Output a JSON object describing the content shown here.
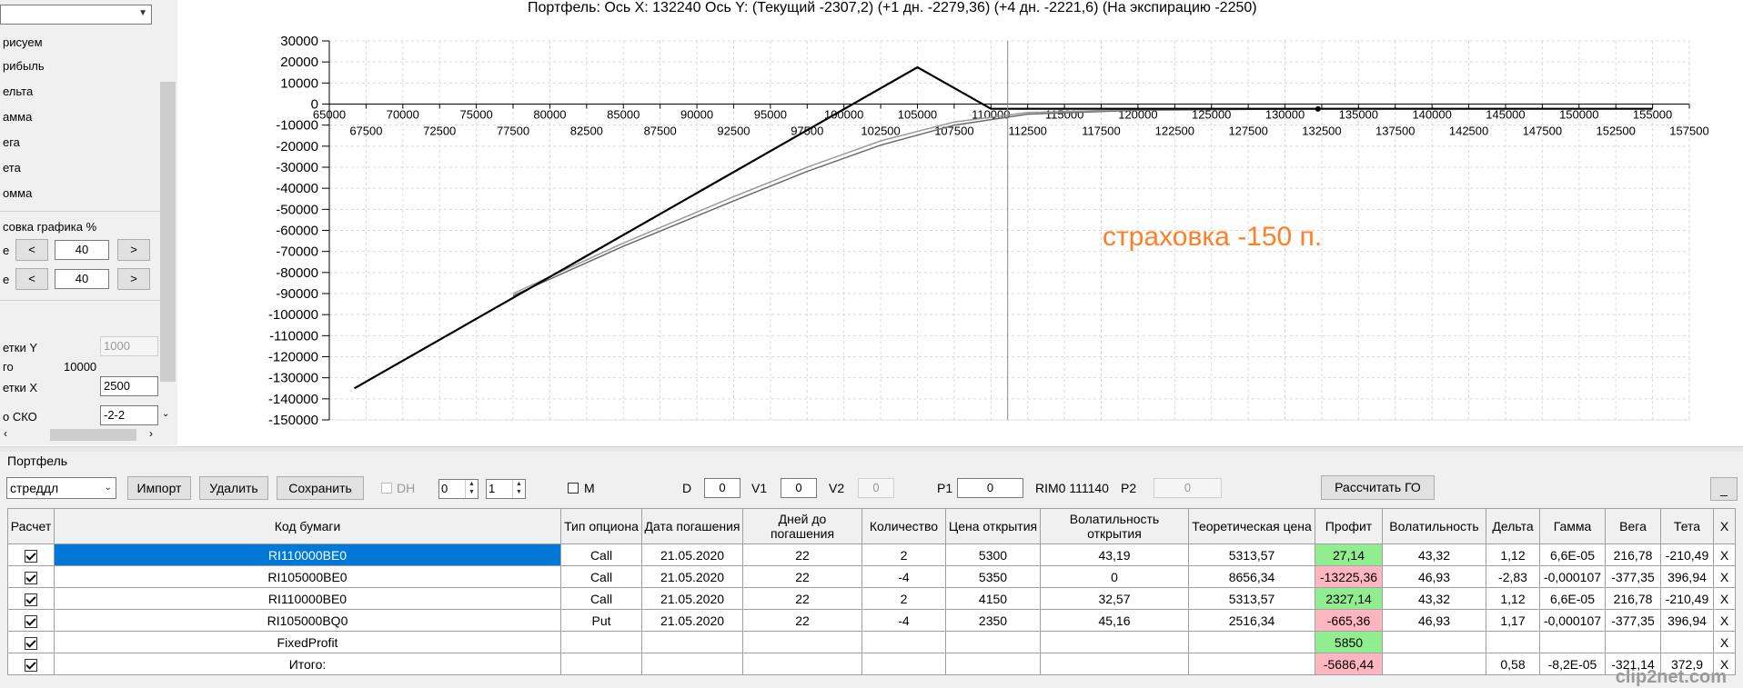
{
  "chart": {
    "title": "Портфель: Ось X: 132240 Ось Y:  (Текущий -2307,2)  (+1 дн. -2279,36)  (+4 дн. -2221,6)  (На экспирацию -2250)",
    "annotation": "страховка -150 п.",
    "annotation_color": "#ff7f27"
  },
  "chart_data": {
    "type": "line",
    "x_top_ticks": [
      65000,
      70000,
      75000,
      80000,
      85000,
      90000,
      95000,
      100000,
      105000,
      110000,
      115000,
      120000,
      125000,
      130000,
      135000,
      140000,
      145000,
      150000,
      155000
    ],
    "x_bottom_ticks": [
      67500,
      72500,
      77500,
      82500,
      87500,
      92500,
      97500,
      102500,
      107500,
      112500,
      117500,
      122500,
      127500,
      132500,
      137500,
      142500,
      147500,
      152500,
      157500
    ],
    "y_ticks": [
      30000,
      20000,
      10000,
      0,
      -10000,
      -20000,
      -30000,
      -40000,
      -50000,
      -60000,
      -70000,
      -80000,
      -90000,
      -100000,
      -110000,
      -120000,
      -130000,
      -140000,
      -150000
    ],
    "xlim": [
      65000,
      157500
    ],
    "ylim": [
      -150000,
      30000
    ],
    "grid": true,
    "cursor_x": 111140,
    "marker_point": {
      "x": 132240,
      "y": -2307
    },
    "series": [
      {
        "color": "#000000",
        "points": [
          [
            66700,
            -135000
          ],
          [
            105000,
            17500
          ],
          [
            110000,
            -2250
          ],
          [
            155000,
            -2250
          ]
        ]
      },
      {
        "color": "#9a9a9a",
        "points": [
          [
            77500,
            -90000
          ],
          [
            85000,
            -66000
          ],
          [
            92500,
            -44000
          ],
          [
            97500,
            -30000
          ],
          [
            102500,
            -17500
          ],
          [
            107500,
            -8500
          ],
          [
            112500,
            -4000
          ],
          [
            120000,
            -2600
          ],
          [
            132240,
            -2279
          ],
          [
            155000,
            -2230
          ]
        ]
      },
      {
        "color": "#6a6a6a",
        "points": [
          [
            77500,
            -91000
          ],
          [
            85000,
            -67500
          ],
          [
            92500,
            -46000
          ],
          [
            97500,
            -32000
          ],
          [
            102500,
            -19500
          ],
          [
            107500,
            -10000
          ],
          [
            112500,
            -4800
          ],
          [
            120000,
            -2900
          ],
          [
            132240,
            -2307
          ],
          [
            155000,
            -2250
          ]
        ]
      }
    ]
  },
  "left_panel": {
    "combo_value": "",
    "items": [
      "рисуем",
      "рибыль",
      "ельта",
      "амма",
      "ега",
      "ета",
      "омма"
    ],
    "scale_label": "совка графика %",
    "row1_label": "е",
    "row1_value": "40",
    "row2_label": "е",
    "row2_value": "40",
    "prev_label": "<",
    "next_label": ">",
    "grid_y_label": "етки Y",
    "grid_y_value": "1000",
    "total_label": "го",
    "total_value": "10000",
    "grid_x_label": "етки X",
    "grid_x_value": "2500",
    "sko_label": "о СКО",
    "sko_value": "-2-2"
  },
  "portfolio": {
    "section_label": "Портфель",
    "portfolio_select": "стреддл",
    "import_label": "Импорт",
    "delete_label": "Удалить",
    "save_label": "Сохранить",
    "dh_label": "DH",
    "spin1_value": "0",
    "spin2_value": "1",
    "m_label": "M",
    "d_label": "D",
    "d_value": "0",
    "v1_label": "V1",
    "v1_value": "0",
    "v2_label": "V2",
    "v2_value": "0",
    "p1_label": "P1",
    "p1_value": "0",
    "rim_text": "RIM0 111140",
    "p2_label": "P2",
    "p2_value": "0",
    "calc_go_label": "Рассчитать ГО",
    "minimize_label": "_"
  },
  "table": {
    "headers": [
      "Расчет",
      "Код бумаги",
      "Тип опциона",
      "Дата погашения",
      "Дней до погашения",
      "Количество",
      "Цена открытия",
      "Волатильность открытия",
      "Теоретическая цена",
      "Профит",
      "Волатильность",
      "Дельта",
      "Гамма",
      "Вега",
      "Тета",
      "X"
    ],
    "rows": [
      [
        "",
        "RI110000BE0",
        "Call",
        "21.05.2020",
        "22",
        "2",
        "5300",
        "43,19",
        "5313,57",
        "27,14",
        "43,32",
        "1,12",
        "6,6E-05",
        "216,78",
        "-210,49",
        "X"
      ],
      [
        "",
        "RI105000BE0",
        "Call",
        "21.05.2020",
        "22",
        "-4",
        "5350",
        "0",
        "8656,34",
        "-13225,36",
        "46,93",
        "-2,83",
        "-0,000107",
        "-377,35",
        "396,94",
        "X"
      ],
      [
        "",
        "RI110000BE0",
        "Call",
        "21.05.2020",
        "22",
        "2",
        "4150",
        "32,57",
        "5313,57",
        "2327,14",
        "43,32",
        "1,12",
        "6,6E-05",
        "216,78",
        "-210,49",
        "X"
      ],
      [
        "",
        "RI105000BQ0",
        "Put",
        "21.05.2020",
        "22",
        "-4",
        "2350",
        "45,16",
        "2516,34",
        "-665,36",
        "46,93",
        "1,17",
        "-0,000107",
        "-377,35",
        "396,94",
        "X"
      ],
      [
        "",
        "FixedProfit",
        "",
        "",
        "",
        "",
        "",
        "",
        "",
        "5850",
        "",
        "",
        "",
        "",
        "",
        "X"
      ],
      [
        "",
        "Итого:",
        "",
        "",
        "",
        "",
        "",
        "",
        "",
        "-5686,44",
        "",
        "0,58",
        "-8,2E-05",
        "-321,14",
        "372,9",
        "X"
      ]
    ],
    "profit_status": [
      "green",
      "red",
      "green",
      "red",
      "green",
      "red"
    ]
  },
  "watermark": "clip2net.com"
}
